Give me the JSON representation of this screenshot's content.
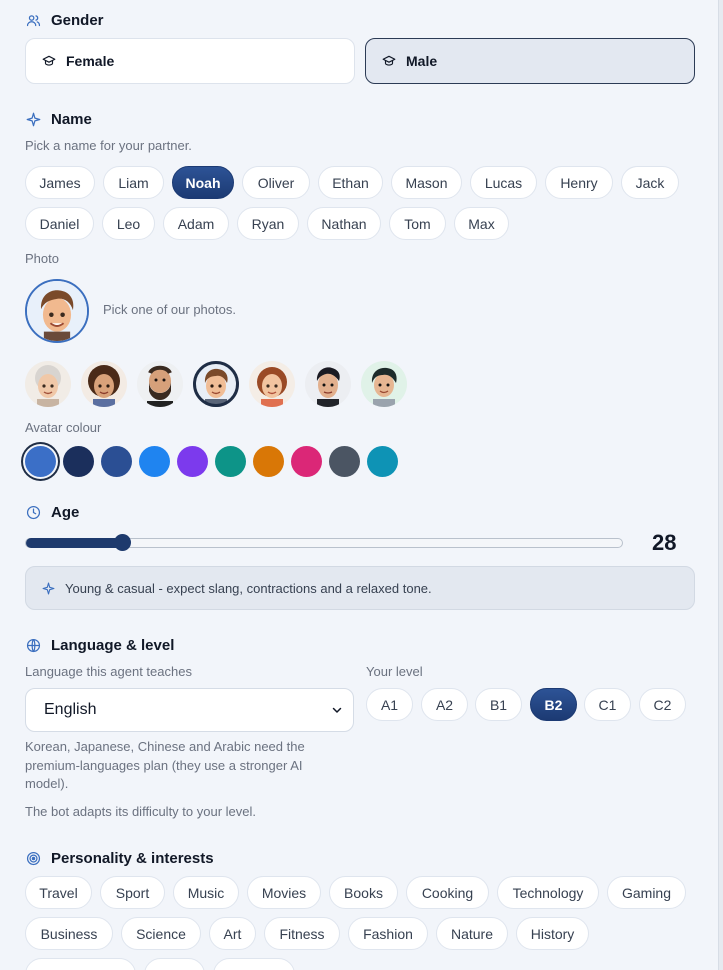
{
  "gender": {
    "title": "Gender",
    "icon": "users-icon",
    "options": [
      {
        "label": "Female",
        "icon": "mortarboard-icon",
        "selected": false
      },
      {
        "label": "Male",
        "icon": "mortarboard-icon",
        "selected": true
      }
    ]
  },
  "name": {
    "title": "Name",
    "icon": "sparkle-icon",
    "hint": "Pick a name for your partner.",
    "options": [
      "James",
      "Liam",
      "Noah",
      "Oliver",
      "Ethan",
      "Mason",
      "Lucas",
      "Henry",
      "Jack",
      "Daniel",
      "Leo",
      "Adam",
      "Ryan",
      "Nathan",
      "Tom",
      "Max"
    ],
    "selected": "Noah"
  },
  "photo": {
    "label": "Photo",
    "hint": "Pick one of our photos.",
    "thumbnails": [
      "elderly-woman-avatar",
      "curly-hair-woman-avatar",
      "bearded-man-avatar",
      "young-man-avatar",
      "redhead-woman-avatar",
      "dark-hair-man-avatar",
      "short-hair-woman-avatar"
    ],
    "selected_index": 3
  },
  "avatar_colour": {
    "label": "Avatar colour",
    "colors": [
      "#3b6fc7",
      "#1b2f5c",
      "#2b4f94",
      "#1f84f0",
      "#7c3aed",
      "#0d9488",
      "#d97706",
      "#db2777",
      "#4b5563",
      "#0e93b5"
    ],
    "selected_index": 0
  },
  "age": {
    "title": "Age",
    "icon": "clock-icon",
    "value": "28",
    "min": 18,
    "max": 80,
    "tone": "Young & casual - expect slang, contractions and a relaxed tone."
  },
  "language": {
    "title": "Language & level",
    "icon": "globe-icon",
    "language_label": "Language this agent teaches",
    "selected_language": "English",
    "level_label": "Your level",
    "levels": [
      "A1",
      "A2",
      "B1",
      "B2",
      "C1",
      "C2"
    ],
    "selected_level": "B2",
    "premium_note": "Korean, Japanese, Chinese and Arabic need the premium-languages plan (they use a stronger AI model).",
    "adapt_note": "The bot adapts its difficulty to your level."
  },
  "personality": {
    "title": "Personality & interests",
    "icon": "target-icon",
    "options": [
      "Travel",
      "Sport",
      "Music",
      "Movies",
      "Books",
      "Cooking",
      "Technology",
      "Gaming",
      "Business",
      "Science",
      "Art",
      "Fitness",
      "Fashion",
      "Nature",
      "History",
      "Photography",
      "Food",
      "Cars"
    ]
  }
}
